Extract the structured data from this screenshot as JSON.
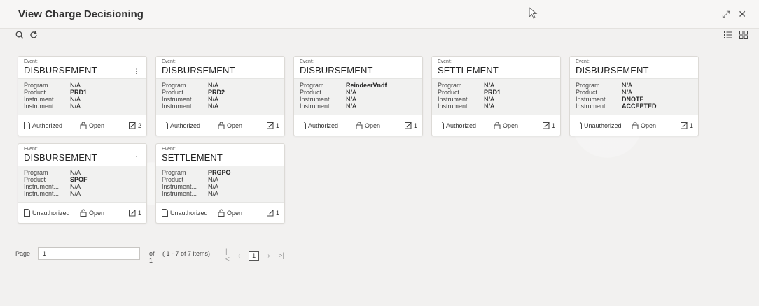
{
  "header": {
    "title": "View Charge Decisioning"
  },
  "cards": [
    {
      "event_label": "Event:",
      "event": "DISBURSEMENT",
      "rows": [
        {
          "k": "Program",
          "v": "N/A"
        },
        {
          "k": "Product",
          "v": "PRD1"
        },
        {
          "k": "Instrument...",
          "v": "N/A"
        },
        {
          "k": "Instrument...",
          "v": "N/A"
        }
      ],
      "status": "Authorized",
      "lock": "Open",
      "edit_count": "2"
    },
    {
      "event_label": "Event:",
      "event": "DISBURSEMENT",
      "rows": [
        {
          "k": "Program",
          "v": "N/A"
        },
        {
          "k": "Product",
          "v": "PRD2"
        },
        {
          "k": "Instrument...",
          "v": "N/A"
        },
        {
          "k": "Instrument...",
          "v": "N/A"
        }
      ],
      "status": "Authorized",
      "lock": "Open",
      "edit_count": "1"
    },
    {
      "event_label": "Event:",
      "event": "DISBURSEMENT",
      "rows": [
        {
          "k": "Program",
          "v": "ReindeerVndf"
        },
        {
          "k": "Product",
          "v": "N/A"
        },
        {
          "k": "Instrument...",
          "v": "N/A"
        },
        {
          "k": "Instrument...",
          "v": "N/A"
        }
      ],
      "status": "Authorized",
      "lock": "Open",
      "edit_count": "1"
    },
    {
      "event_label": "Event:",
      "event": "SETTLEMENT",
      "rows": [
        {
          "k": "Program",
          "v": "N/A"
        },
        {
          "k": "Product",
          "v": "PRD1"
        },
        {
          "k": "Instrument...",
          "v": "N/A"
        },
        {
          "k": "Instrument...",
          "v": "N/A"
        }
      ],
      "status": "Authorized",
      "lock": "Open",
      "edit_count": "1"
    },
    {
      "event_label": "Event:",
      "event": "DISBURSEMENT",
      "rows": [
        {
          "k": "Program",
          "v": "N/A"
        },
        {
          "k": "Product",
          "v": "N/A"
        },
        {
          "k": "Instrument...",
          "v": "DNOTE"
        },
        {
          "k": "Instrument...",
          "v": "ACCEPTED"
        }
      ],
      "status": "Unauthorized",
      "lock": "Open",
      "edit_count": "1"
    },
    {
      "event_label": "Event:",
      "event": "DISBURSEMENT",
      "rows": [
        {
          "k": "Program",
          "v": "N/A"
        },
        {
          "k": "Product",
          "v": "SPOF"
        },
        {
          "k": "Instrument...",
          "v": "N/A"
        },
        {
          "k": "Instrument...",
          "v": "N/A"
        }
      ],
      "status": "Unauthorized",
      "lock": "Open",
      "edit_count": "1"
    },
    {
      "event_label": "Event:",
      "event": "SETTLEMENT",
      "rows": [
        {
          "k": "Program",
          "v": "PRGPO"
        },
        {
          "k": "Product",
          "v": "N/A"
        },
        {
          "k": "Instrument...",
          "v": "N/A"
        },
        {
          "k": "Instrument...",
          "v": "N/A"
        }
      ],
      "status": "Unauthorized",
      "lock": "Open",
      "edit_count": "1"
    }
  ],
  "pagination": {
    "page_label": "Page",
    "page_value": "1",
    "of_label": "of 1",
    "items_label": "( 1 - 7 of 7 items)",
    "current_page": "1"
  },
  "icons": {
    "search": "search-icon",
    "refresh": "refresh-icon",
    "list_view": "list-view-icon",
    "grid_view": "grid-view-icon",
    "expand": "expand-icon",
    "close": "close-icon"
  }
}
